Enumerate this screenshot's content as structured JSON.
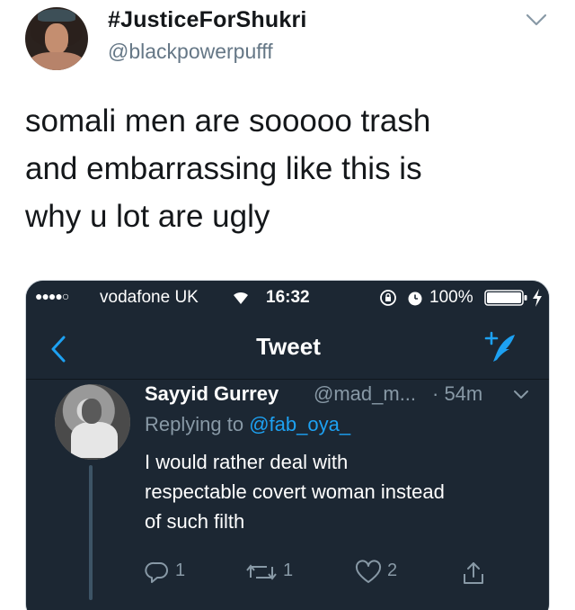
{
  "outer_tweet": {
    "display_name": "#JusticeForShukri",
    "handle": "@blackpowerpufff",
    "text_lines": [
      "somali men are sooooo trash",
      "and embarrassing like this is",
      "why u lot are ugly"
    ],
    "icons": {
      "avatar": "profile-photo",
      "menu": "chevron-down-icon"
    }
  },
  "screenshot": {
    "status_bar": {
      "signal": "●●●●○",
      "carrier": "vodafone UK",
      "time": "16:32",
      "battery": "100%",
      "battery_level": 1.0,
      "icons": [
        "wifi-icon",
        "rotation-lock-icon",
        "alarm-icon",
        "battery-icon",
        "charging-bolt-icon"
      ]
    },
    "nav": {
      "title": "Tweet",
      "icons": [
        "back-arrow-icon",
        "compose-tweet-icon"
      ]
    },
    "reply": {
      "name": "Sayyid Gurrey",
      "handle": "@mad_m...",
      "time": "· 54m",
      "replying_prefix": "Replying to",
      "replying_to": "@fab_oya_",
      "body_lines": [
        "I would rather deal with",
        "respectable covert woman instead",
        "of such filth"
      ],
      "actions": {
        "reply_count": "1",
        "retweet_count": "1",
        "like_count": "2"
      }
    }
  },
  "colors": {
    "dark_bg": "#1c2733",
    "accent_blue": "#1da1f2",
    "muted_text": "#8899a6",
    "outer_muted": "#657786"
  }
}
